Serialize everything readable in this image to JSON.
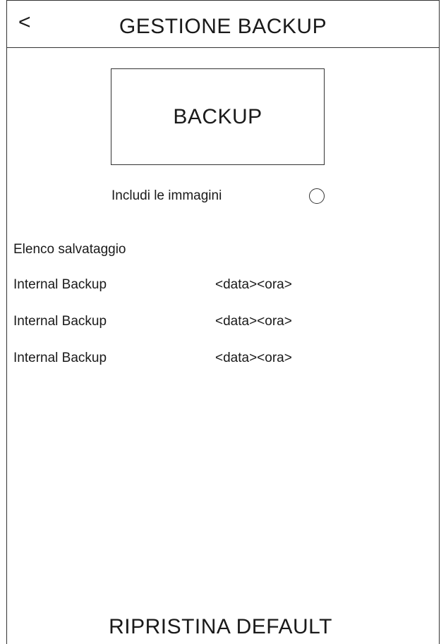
{
  "header": {
    "back_label": "<",
    "title": "GESTIONE BACKUP"
  },
  "backup_button": {
    "label": "BACKUP"
  },
  "include_images": {
    "label": "Includi le immagini",
    "checked": false
  },
  "backup_list": {
    "heading": "Elenco salvataggio",
    "items": [
      {
        "name": "Internal Backup",
        "datetime": "<data><ora>"
      },
      {
        "name": "Internal Backup",
        "datetime": "<data><ora>"
      },
      {
        "name": "Internal Backup",
        "datetime": "<data><ora>"
      }
    ]
  },
  "restore_button": {
    "label": "RIPRISTINA DEFAULT"
  }
}
